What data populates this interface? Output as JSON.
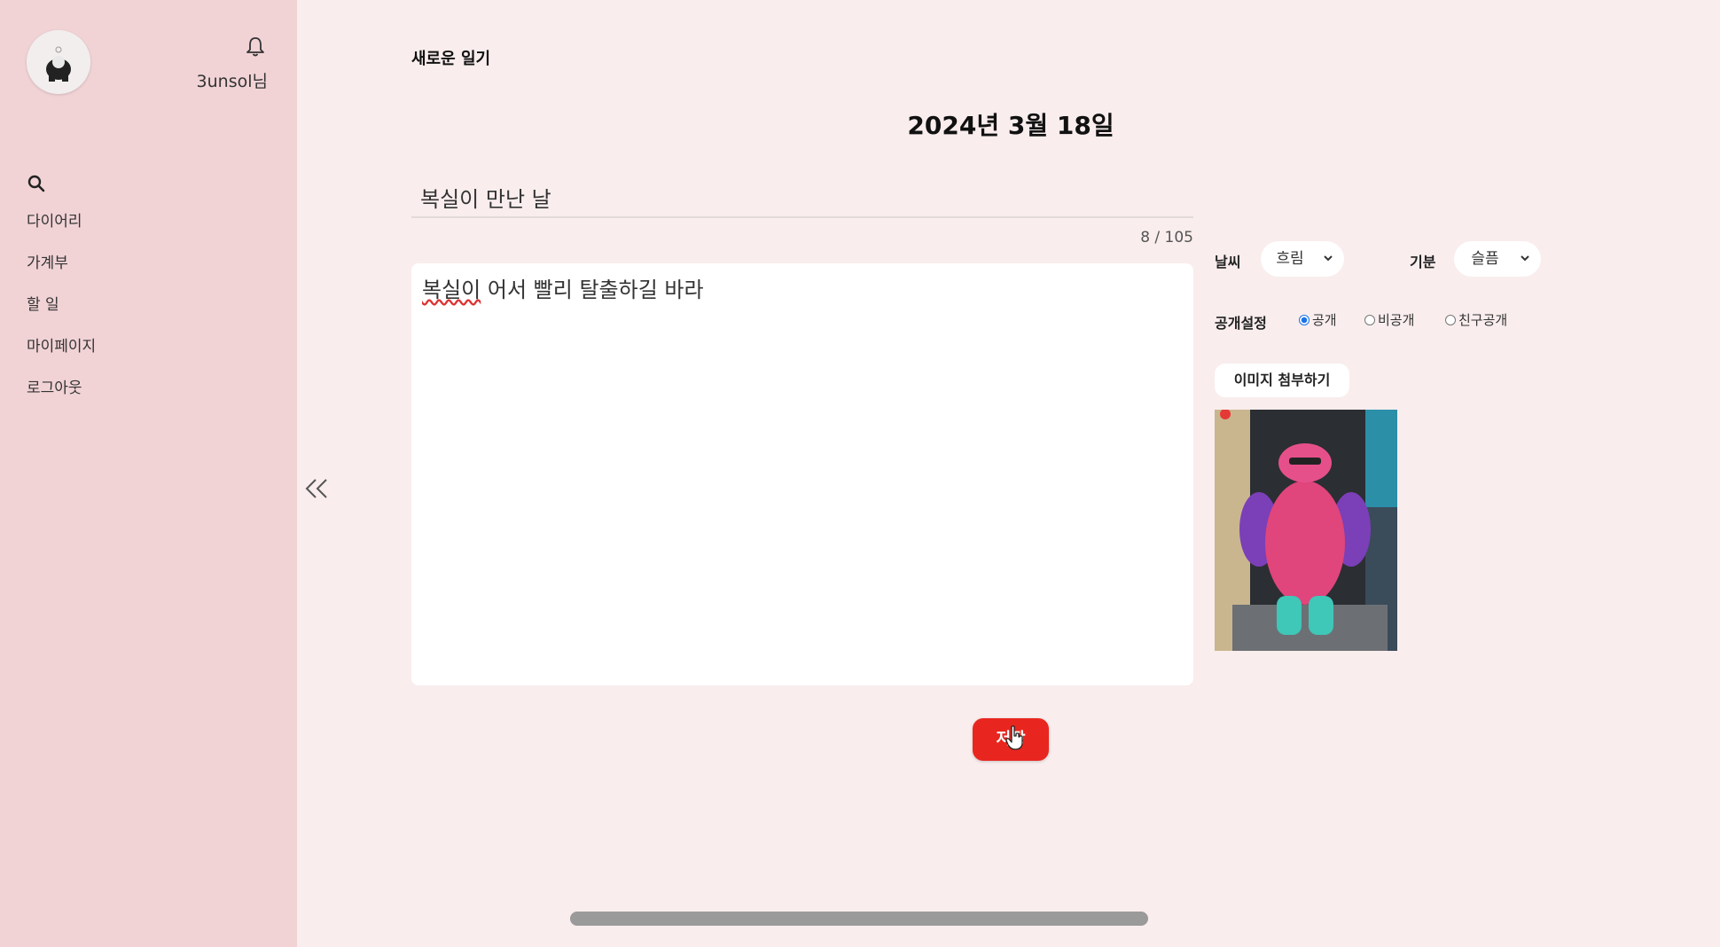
{
  "sidebar": {
    "username": "3unsol님",
    "items": [
      {
        "label": "다이어리"
      },
      {
        "label": "가계부"
      },
      {
        "label": "할 일"
      },
      {
        "label": "마이페이지"
      },
      {
        "label": "로그아웃"
      }
    ],
    "collapse_label": "<<"
  },
  "editor": {
    "page_label": "새로운 일기",
    "date": "2024년 3월 18일",
    "title_value": "복실이 만난 날",
    "char_count": "8 / 105",
    "content_first": "복실이",
    "content_rest": " 어서 빨리 탈출하길 바라"
  },
  "options": {
    "weather_label": "날씨",
    "weather_value": "흐림",
    "mood_label": "기분",
    "mood_value": "슬픔",
    "visibility_label": "공개설정",
    "visibility_options": [
      {
        "label": "공개",
        "checked": true
      },
      {
        "label": "비공개",
        "checked": false
      },
      {
        "label": "친구공개",
        "checked": false
      }
    ],
    "attach_label": "이미지 첨부하기"
  },
  "save_label": "저장",
  "colors": {
    "sidebar_bg": "#f1d3d6",
    "page_bg": "#f9eded",
    "save_button": "#e8261f",
    "radio_selected": "#1a73e8"
  }
}
